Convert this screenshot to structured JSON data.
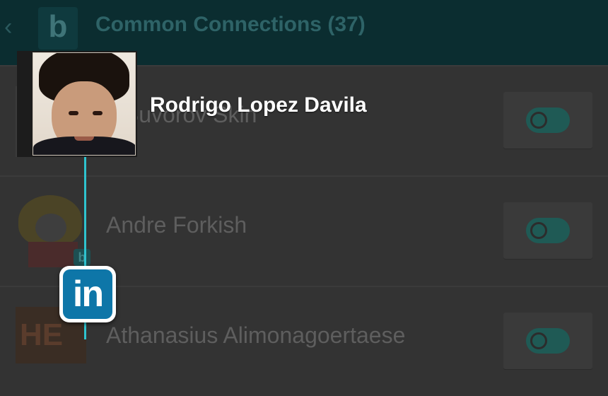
{
  "topbar": {
    "back_glyph": "‹",
    "app_logo_glyph": "b",
    "title": "Common Connections (37)"
  },
  "connections": [
    {
      "name": "x Suvorov Skin",
      "action_icon": "toggle-icon"
    },
    {
      "name": "Andre Forkish",
      "avatar_badge": "b",
      "action_icon": "toggle-icon"
    },
    {
      "name": "Athanasius Alimonagoertaese",
      "thumb_text": "HE",
      "action_icon": "toggle-icon"
    }
  ],
  "overlay": {
    "profile_name": "Rodrigo Lopez Davila",
    "network_badge": "in",
    "accent_color": "#2ec3cf",
    "linkedin_color": "#0e76a8"
  }
}
